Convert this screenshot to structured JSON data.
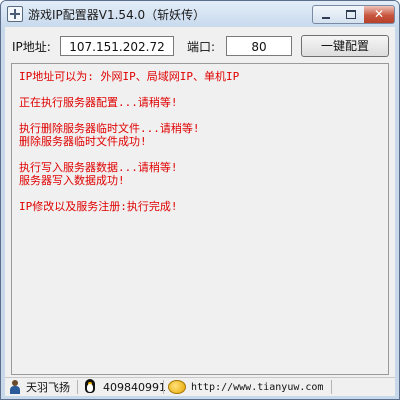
{
  "window": {
    "title": "游戏IP配置器V1.54.0（斩妖传）",
    "close_glyph": "✕"
  },
  "form": {
    "ip_label": "IP地址:",
    "ip_value": "107.151.202.72",
    "port_label": "端口:",
    "port_value": "80",
    "config_button": "一键配置"
  },
  "log": {
    "lines": [
      "IP地址可以为:  外网IP、局域网IP、单机IP",
      "",
      "正在执行服务器配置...请稍等!",
      "",
      "执行删除服务器临时文件...请稍等!",
      "删除服务器临时文件成功!",
      "",
      "执行写入服务器数据...请稍等!",
      "服务器写入数据成功!",
      "",
      "IP修改以及服务注册:执行完成!"
    ]
  },
  "statusbar": {
    "author": "天羽飞扬",
    "qq": "409840991",
    "url": "http://www.tianyuw.com"
  },
  "colors": {
    "log_text": "#e00000",
    "titlebar": "#c9daee",
    "close_button": "#c8563f"
  }
}
